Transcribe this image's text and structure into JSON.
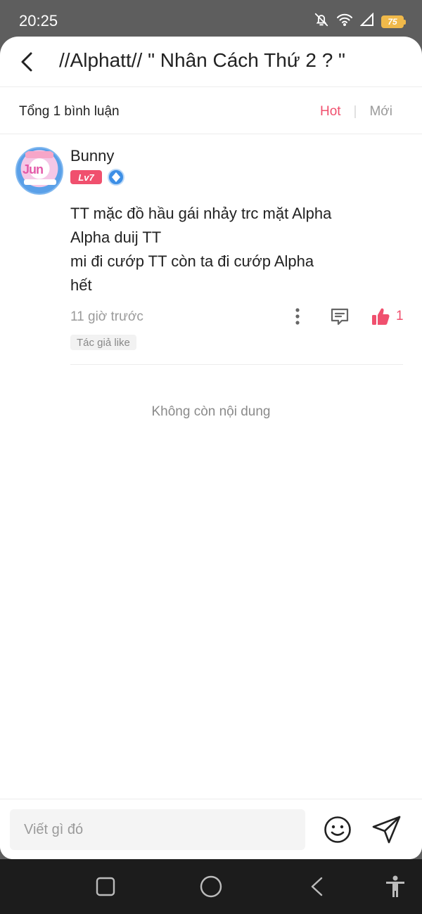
{
  "status_bar": {
    "time": "20:25",
    "battery": "75"
  },
  "header": {
    "title": "//Alphatt// \" Nhân Cách Thứ 2 ? \""
  },
  "summary": {
    "total_comments": "Tổng 1 bình luận",
    "sort_hot": "Hot",
    "sort_new": "Mới",
    "active_sort_color": "#f0506e"
  },
  "comment": {
    "username": "Bunny",
    "level_badge": "Lv7",
    "avatar_icon": "writer-avatar",
    "role_icon": "verified-writer-icon",
    "body_lines": [
      "TT mặc đồ hầu gái nhảy trc mặt Alpha",
      "Alpha duij TT",
      "mi đi cướp TT còn ta đi cướp Alpha",
      "hết"
    ],
    "timestamp": "11 giờ trước",
    "like_count": "1",
    "author_like_tag": "Tác giả like"
  },
  "end_note": "Không còn nội dung",
  "input": {
    "placeholder": "Viết gì đó"
  },
  "colors": {
    "accent": "#f0506e",
    "text": "#222222",
    "muted": "#9a9a9a"
  }
}
